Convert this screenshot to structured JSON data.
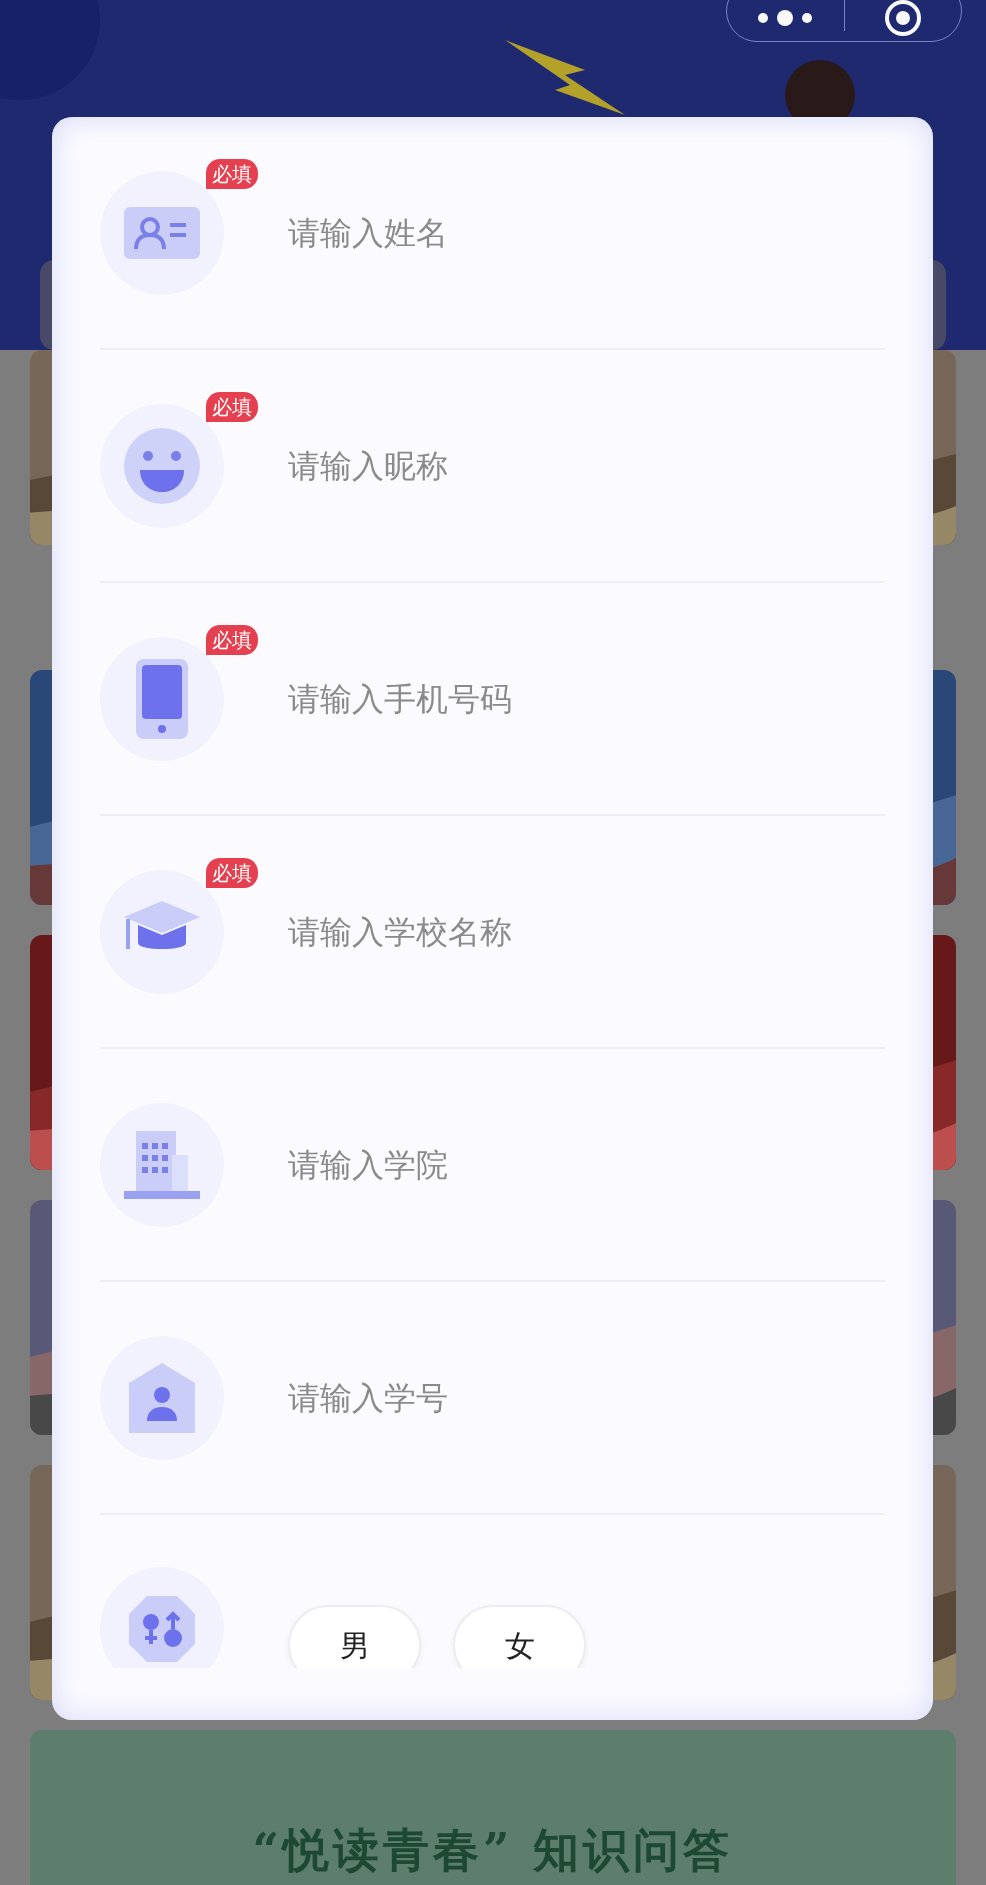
{
  "form": {
    "fields": [
      {
        "placeholder": "请输入姓名",
        "badge": "必填"
      },
      {
        "placeholder": "请输入昵称",
        "badge": "必填"
      },
      {
        "placeholder": "请输入手机号码",
        "badge": "必填"
      },
      {
        "placeholder": "请输入学校名称",
        "badge": "必填"
      },
      {
        "placeholder": "请输入学院"
      },
      {
        "placeholder": "请输入学号"
      }
    ],
    "gender": {
      "options": [
        {
          "label": "男",
          "selected": false
        },
        {
          "label": "女",
          "selected": false
        }
      ]
    }
  },
  "banner": {
    "title": "“悦读青春” 知识问答"
  }
}
